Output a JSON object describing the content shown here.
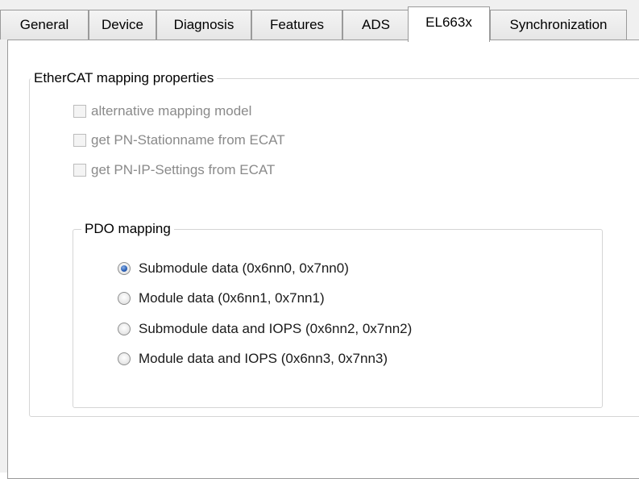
{
  "tabs": [
    {
      "label": "General",
      "active": false
    },
    {
      "label": "Device",
      "active": false
    },
    {
      "label": "Diagnosis",
      "active": false
    },
    {
      "label": "Features",
      "active": false
    },
    {
      "label": "ADS",
      "active": false
    },
    {
      "label": "EL663x",
      "active": true
    },
    {
      "label": "Synchronization",
      "active": false
    }
  ],
  "ethercat_group": {
    "title": "EtherCAT mapping properties",
    "checkboxes": [
      {
        "label": "alternative mapping model",
        "checked": false,
        "enabled": false
      },
      {
        "label": "get PN-Stationname from ECAT",
        "checked": false,
        "enabled": false
      },
      {
        "label": "get PN-IP-Settings from ECAT",
        "checked": false,
        "enabled": false
      }
    ]
  },
  "pdo_group": {
    "title": "PDO mapping",
    "options": [
      {
        "label": "Submodule data (0x6nn0, 0x7nn0)",
        "selected": true
      },
      {
        "label": "Module data (0x6nn1, 0x7nn1)",
        "selected": false
      },
      {
        "label": "Submodule data and IOPS (0x6nn2, 0x7nn2)",
        "selected": false
      },
      {
        "label": "Module data and IOPS (0x6nn3, 0x7nn3)",
        "selected": false
      }
    ]
  },
  "colors": {
    "disabled_text": "#8a8a8a",
    "radio_selected": "#2c62b8",
    "tab_border": "#9a9a9a",
    "group_border": "#d5d5d5"
  }
}
